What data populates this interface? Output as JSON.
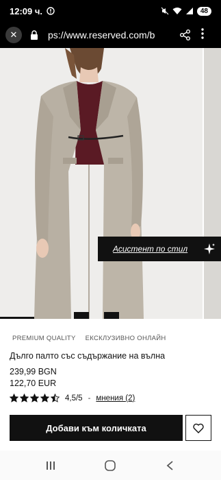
{
  "status_bar": {
    "time": "12:09 ч.",
    "battery": "48"
  },
  "url_bar": {
    "url": "ps://www.reserved.com/b"
  },
  "assistant": {
    "label": "Асистент по стил"
  },
  "product": {
    "tags": [
      "PREMIUM QUALITY",
      "ЕКСКЛУЗИВНО ОНЛАЙН"
    ],
    "title": "Дълго палто със съдържание на вълна",
    "price_bgn": "239,99 BGN",
    "price_eur": "122,70 EUR",
    "rating": {
      "stars_value": 4.5,
      "value_text": "4,5/5",
      "separator": "-",
      "reviews_text": "мнения (2)"
    },
    "add_to_cart_label": "Добави към количката"
  },
  "colors": {
    "accent": "#111111",
    "coat": "#b8b0a3",
    "sweater": "#5a1a24"
  },
  "icons": [
    "close-icon",
    "lock-icon",
    "share-icon",
    "more-vert-icon",
    "sparkle-icon",
    "heart-icon",
    "star-icon",
    "recent-apps-icon",
    "home-icon",
    "back-icon"
  ]
}
